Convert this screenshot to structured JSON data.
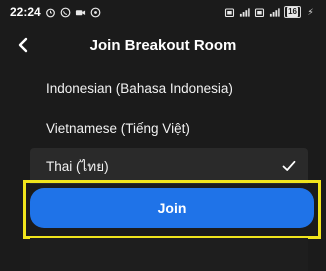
{
  "status_bar": {
    "time": "22:24",
    "left_icons": [
      "alarm-icon",
      "whatsapp-icon",
      "video-icon",
      "lock-icon"
    ],
    "right_icons": [
      "sim-icon",
      "signal-icon-1",
      "sim-icon-2",
      "signal-icon-2"
    ],
    "battery_level": "16",
    "charging": "⚡"
  },
  "header": {
    "back_glyph": "‹",
    "title": "Join Breakout Room"
  },
  "options": [
    {
      "label": "Indonesian (Bahasa Indonesia)",
      "selected": false
    },
    {
      "label": "Vietnamese (Tiếng Việt)",
      "selected": false
    },
    {
      "label": "Thai (ไทย)",
      "selected": true
    }
  ],
  "join_button": {
    "label": "Join"
  },
  "colors": {
    "background": "#1b1b1b",
    "accent": "#1f73e8",
    "highlight": "#f1e51c"
  }
}
